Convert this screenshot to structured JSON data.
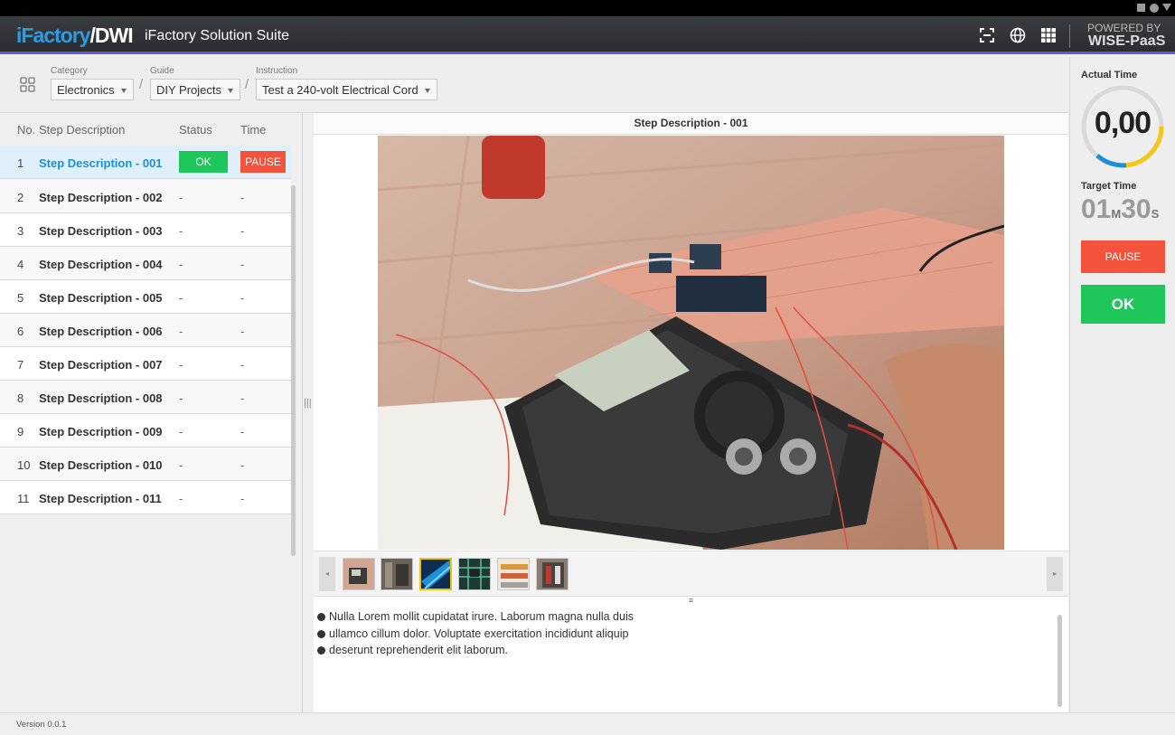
{
  "header": {
    "logo_part1": "iFactory",
    "logo_part2": "/DWI",
    "title": "iFactory Solution Suite",
    "icons": [
      "fullscreen-icon",
      "globe-icon",
      "apps-grid-icon"
    ],
    "powered_by": "POWERED BY",
    "brand": "WISE-PaaS",
    "accent_color": "#5b5bd6"
  },
  "breadcrumb": {
    "category": {
      "label": "Category",
      "value": "Electronics"
    },
    "guide": {
      "label": "Guide",
      "value": "DIY Projects"
    },
    "instruction": {
      "label": "Instruction",
      "value": "Test a 240-volt Electrical Cord"
    },
    "separator": "/"
  },
  "steps": {
    "columns": {
      "no": "No.",
      "description": "Step Description",
      "status": "Status",
      "time": "Time"
    },
    "rows": [
      {
        "no": "1",
        "description": "Step Description - 001",
        "status": "OK",
        "time": "PAUSE",
        "active": true
      },
      {
        "no": "2",
        "description": "Step Description - 002",
        "status": "-",
        "time": "-"
      },
      {
        "no": "3",
        "description": "Step Description - 003",
        "status": "-",
        "time": "-"
      },
      {
        "no": "4",
        "description": "Step Description - 004",
        "status": "-",
        "time": "-"
      },
      {
        "no": "5",
        "description": "Step Description - 005",
        "status": "-",
        "time": "-"
      },
      {
        "no": "6",
        "description": "Step Description - 006",
        "status": "-",
        "time": "-"
      },
      {
        "no": "7",
        "description": "Step Description - 007",
        "status": "-",
        "time": "-"
      },
      {
        "no": "8",
        "description": "Step Description - 008",
        "status": "-",
        "time": "-"
      },
      {
        "no": "9",
        "description": "Step Description - 009",
        "status": "-",
        "time": "-"
      },
      {
        "no": "10",
        "description": "Step Description - 010",
        "status": "-",
        "time": "-"
      },
      {
        "no": "11",
        "description": "Step Description - 011",
        "status": "-",
        "time": "-"
      }
    ]
  },
  "viewer": {
    "title": "Step Description - 001",
    "thumbnail_count": 6,
    "selected_thumbnail": 3,
    "notes": [
      "Nulla Lorem mollit cupidatat irure. Laborum magna nulla duis",
      "ullamco cillum dolor. Voluptate exercitation incididunt aliquip",
      "deserunt reprehenderit elit laborum."
    ]
  },
  "timer": {
    "actual_label": "Actual Time",
    "actual_value": "0,00",
    "target_label": "Target Time",
    "target_minutes": "01",
    "minutes_unit": "M",
    "target_seconds": "30",
    "seconds_unit": "S",
    "pause_label": "PAUSE",
    "ok_label": "OK",
    "gauge_colors": [
      "#f5c518",
      "#1e8fd6"
    ]
  },
  "footer": {
    "version": "Version 0.0.1"
  }
}
